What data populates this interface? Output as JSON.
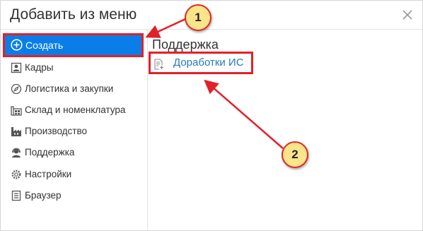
{
  "dialog": {
    "title": "Добавить из меню",
    "close_icon": "close-icon"
  },
  "sidebar": {
    "create_label": "Создать",
    "items": [
      {
        "label": "Кадры",
        "icon": "personnel-icon"
      },
      {
        "label": "Логистика и закупки",
        "icon": "compass-icon"
      },
      {
        "label": "Склад и номенклатура",
        "icon": "warehouse-icon"
      },
      {
        "label": "Производство",
        "icon": "factory-icon"
      },
      {
        "label": "Поддержка",
        "icon": "support-agent-icon"
      },
      {
        "label": "Настройки",
        "icon": "gear-icon"
      },
      {
        "label": "Браузер",
        "icon": "browser-icon"
      }
    ]
  },
  "content": {
    "section_title": "Поддержка",
    "items": [
      {
        "label": "Доработки ИС",
        "icon": "add-document-icon"
      }
    ]
  },
  "annotations": {
    "badge1": "1",
    "badge2": "2",
    "color": "#e3202a",
    "badge_fill": "#fbe48a"
  }
}
